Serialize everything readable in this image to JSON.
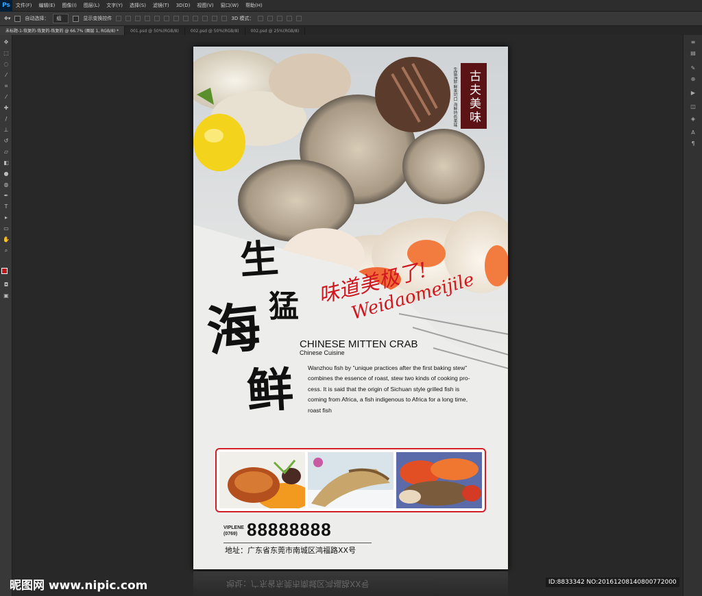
{
  "app": {
    "logo": "Ps"
  },
  "menu": [
    "文件(F)",
    "编辑(E)",
    "图像(I)",
    "图层(L)",
    "文字(Y)",
    "选择(S)",
    "滤镜(T)",
    "3D(D)",
    "视图(V)",
    "窗口(W)",
    "帮助(H)"
  ],
  "options": {
    "auto_select_label": "自动选择：",
    "auto_select_value": "组",
    "show_transform_label": "显示变换控件",
    "mode_3d_label": "3D 模式："
  },
  "tabs": [
    "未标题-1-恢复的-恢复的-恢复的 @ 66.7% (图层 1, RGB/8) *",
    "001.psd @ 50%(RGB/8)",
    "002.psd @ 50%(RGB/8)",
    "002.psd @ 25%(RGB/8)"
  ],
  "poster": {
    "seal": "古夫美味",
    "seal_sub": "生猛海鲜·鲜美可口 海鲜特色美味",
    "headline": [
      "生",
      "猛",
      "海",
      "鲜"
    ],
    "script_cn": "味道美极了!",
    "script_latin": "Weidaomeijile",
    "en_title": "CHINESE MITTEN CRAB",
    "en_sub": "Chinese   Cuisine",
    "body_lines": [
      "Wanzhou fish by \"unique practices after the first baking stew\"",
      "combines the essence of roast, stew two kinds of cooking pro-",
      "cess. It is said that the origin of Sichuan style grilled fish is",
      "coming from Africa, a fish indigenous to Africa for a long time,",
      "roast fish"
    ],
    "viplene": "VIPLENE",
    "area_code": "(0769)",
    "phone": "88888888",
    "address": "地址：广东省东莞市南城区鸿福路XX号"
  },
  "watermark": {
    "left": "昵图网 www.nipic.com",
    "right": "ID:8833342 NO:20161208140800772000"
  },
  "colors": {
    "accent_red": "#d21f25",
    "seal_brown": "#5c1315",
    "ps_blue": "#31a8ff"
  }
}
